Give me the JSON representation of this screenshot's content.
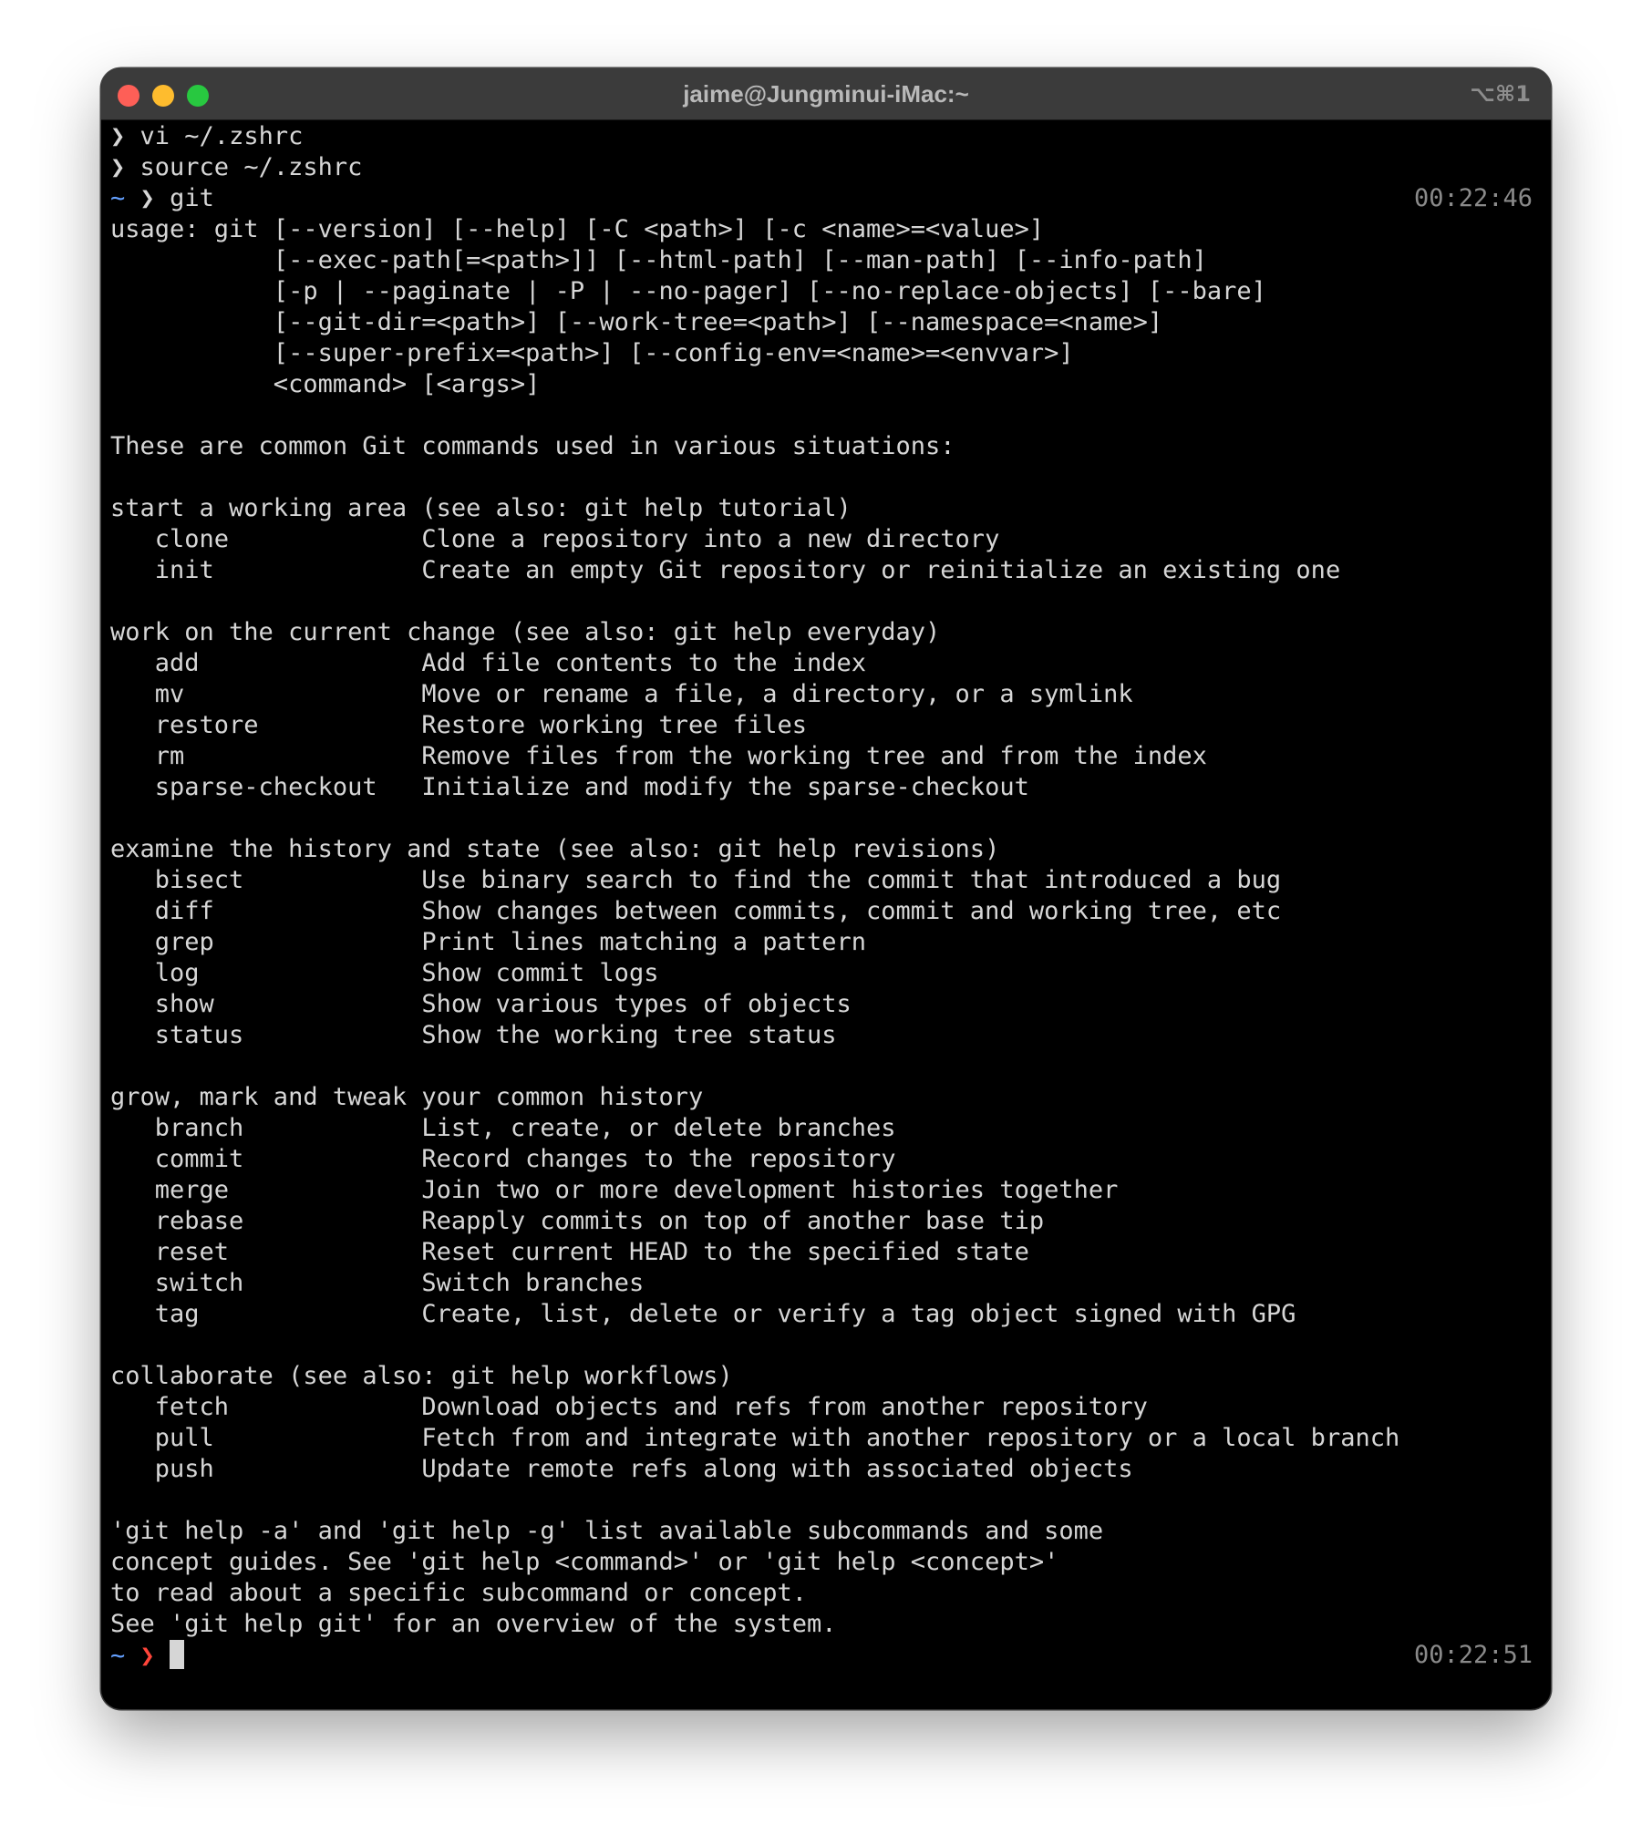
{
  "window": {
    "title": "jaime@Jungminui-iMac:~",
    "shortcut": "⌥⌘1"
  },
  "prompt": {
    "arrow": "❯",
    "home": "~"
  },
  "history": [
    "vi ~/.zshrc",
    "source ~/.zshrc"
  ],
  "command": {
    "text": "git",
    "time": "00:22:46"
  },
  "output": [
    "usage: git [--version] [--help] [-C <path>] [-c <name>=<value>]",
    "           [--exec-path[=<path>]] [--html-path] [--man-path] [--info-path]",
    "           [-p | --paginate | -P | --no-pager] [--no-replace-objects] [--bare]",
    "           [--git-dir=<path>] [--work-tree=<path>] [--namespace=<name>]",
    "           [--super-prefix=<path>] [--config-env=<name>=<envvar>]",
    "           <command> [<args>]",
    "",
    "These are common Git commands used in various situations:",
    "",
    "start a working area (see also: git help tutorial)",
    "   clone             Clone a repository into a new directory",
    "   init              Create an empty Git repository or reinitialize an existing one",
    "",
    "work on the current change (see also: git help everyday)",
    "   add               Add file contents to the index",
    "   mv                Move or rename a file, a directory, or a symlink",
    "   restore           Restore working tree files",
    "   rm                Remove files from the working tree and from the index",
    "   sparse-checkout   Initialize and modify the sparse-checkout",
    "",
    "examine the history and state (see also: git help revisions)",
    "   bisect            Use binary search to find the commit that introduced a bug",
    "   diff              Show changes between commits, commit and working tree, etc",
    "   grep              Print lines matching a pattern",
    "   log               Show commit logs",
    "   show              Show various types of objects",
    "   status            Show the working tree status",
    "",
    "grow, mark and tweak your common history",
    "   branch            List, create, or delete branches",
    "   commit            Record changes to the repository",
    "   merge             Join two or more development histories together",
    "   rebase            Reapply commits on top of another base tip",
    "   reset             Reset current HEAD to the specified state",
    "   switch            Switch branches",
    "   tag               Create, list, delete or verify a tag object signed with GPG",
    "",
    "collaborate (see also: git help workflows)",
    "   fetch             Download objects and refs from another repository",
    "   pull              Fetch from and integrate with another repository or a local branch",
    "   push              Update remote refs along with associated objects",
    "",
    "'git help -a' and 'git help -g' list available subcommands and some",
    "concept guides. See 'git help <command>' or 'git help <concept>'",
    "to read about a specific subcommand or concept.",
    "See 'git help git' for an overview of the system."
  ],
  "final_prompt": {
    "time": "00:22:51"
  },
  "colors": {
    "background": "#000000",
    "titlebar": "#3b3b3b",
    "text": "#d6d6d6",
    "tilde": "#64a0ff",
    "error_arrow": "#ff453a",
    "timestamp": "#8a8a8a"
  }
}
